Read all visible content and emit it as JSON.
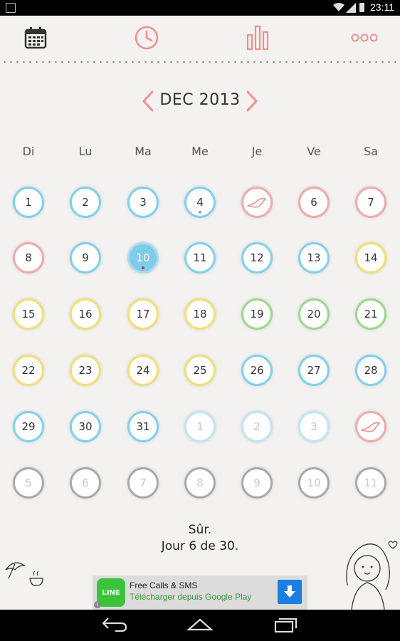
{
  "status_bar": {
    "time": "23:11"
  },
  "nav": {
    "icons": [
      "calendar-icon",
      "clock-icon",
      "bar-chart-icon",
      "more-icon"
    ],
    "accent": "#ef8f8f"
  },
  "calendar": {
    "month_label": "DEC 2013",
    "weekdays": [
      "Di",
      "Lu",
      "Ma",
      "Me",
      "Je",
      "Ve",
      "Sa"
    ],
    "weeks": [
      [
        {
          "t": "1",
          "c": "blue"
        },
        {
          "t": "2",
          "c": "blue"
        },
        {
          "t": "3",
          "c": "blue"
        },
        {
          "t": "4",
          "c": "blue",
          "dot": "#999999"
        },
        {
          "t": "",
          "c": "pink",
          "icon": "shoe"
        },
        {
          "t": "6",
          "c": "pink"
        },
        {
          "t": "7",
          "c": "pink"
        }
      ],
      [
        {
          "t": "8",
          "c": "pink"
        },
        {
          "t": "9",
          "c": "blue"
        },
        {
          "t": "10",
          "c": "today",
          "dot": "#d23c3c"
        },
        {
          "t": "11",
          "c": "blue"
        },
        {
          "t": "12",
          "c": "blue"
        },
        {
          "t": "13",
          "c": "blue"
        },
        {
          "t": "14",
          "c": "yellow"
        }
      ],
      [
        {
          "t": "15",
          "c": "yellow"
        },
        {
          "t": "16",
          "c": "yellow"
        },
        {
          "t": "17",
          "c": "yellow"
        },
        {
          "t": "18",
          "c": "yellow"
        },
        {
          "t": "19",
          "c": "green"
        },
        {
          "t": "20",
          "c": "green"
        },
        {
          "t": "21",
          "c": "green"
        }
      ],
      [
        {
          "t": "22",
          "c": "yellow"
        },
        {
          "t": "23",
          "c": "yellow"
        },
        {
          "t": "24",
          "c": "yellow"
        },
        {
          "t": "25",
          "c": "yellow"
        },
        {
          "t": "26",
          "c": "blue"
        },
        {
          "t": "27",
          "c": "blue"
        },
        {
          "t": "28",
          "c": "blue"
        }
      ],
      [
        {
          "t": "29",
          "c": "blue"
        },
        {
          "t": "30",
          "c": "blue"
        },
        {
          "t": "31",
          "c": "blue"
        },
        {
          "t": "1",
          "c": "blue",
          "faded": true
        },
        {
          "t": "2",
          "c": "blue",
          "faded": true
        },
        {
          "t": "3",
          "c": "blue",
          "faded": true
        },
        {
          "t": "",
          "c": "pink",
          "icon": "shoe"
        }
      ],
      [
        {
          "t": "5",
          "c": "grey",
          "faded": true
        },
        {
          "t": "6",
          "c": "grey",
          "faded": true
        },
        {
          "t": "7",
          "c": "grey",
          "faded": true
        },
        {
          "t": "8",
          "c": "grey",
          "faded": true
        },
        {
          "t": "9",
          "c": "grey",
          "faded": true
        },
        {
          "t": "10",
          "c": "grey",
          "faded": true
        },
        {
          "t": "11",
          "c": "grey",
          "faded": true
        }
      ]
    ]
  },
  "status_text": {
    "line1": "Sûr.",
    "line2": "Jour 6 de 30."
  },
  "ad": {
    "logo": "LINE",
    "title": "Free Calls & SMS",
    "subtitle": "Télécharger depuis Google Play",
    "info": "i"
  }
}
